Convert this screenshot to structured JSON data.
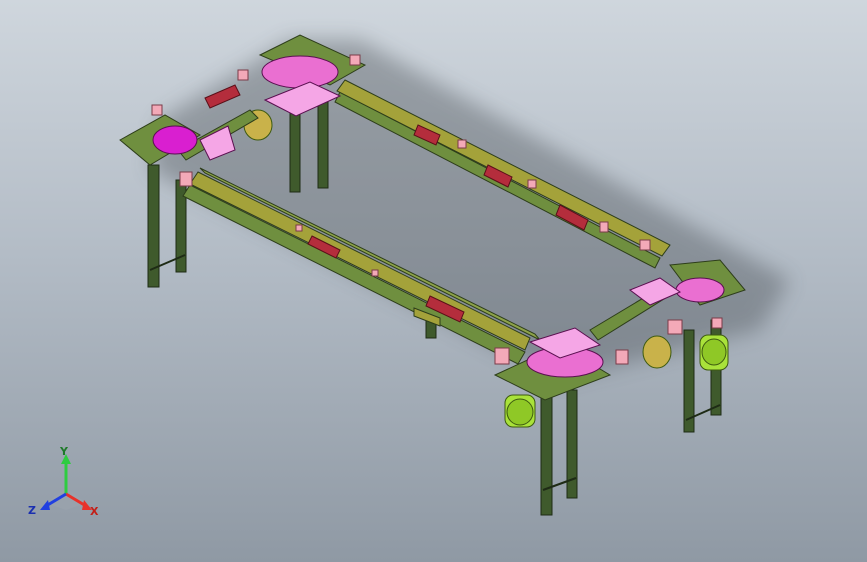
{
  "viewport": {
    "background_top": "#cfd6dd",
    "background_bottom": "#8f99a4"
  },
  "model": {
    "type": "conveyor-frame-assembly",
    "colors": {
      "frame": "#6f8f3f",
      "rail": "#a4a23a",
      "pink": "#ea6fd1",
      "magenta": "#d91fd0",
      "red_block": "#b42d3c",
      "motor": "#a9e23a",
      "leg": "#3f5a2c"
    }
  },
  "triad": {
    "y_label": "Y",
    "x_label": "X",
    "z_label": "Z",
    "y_color": "#2ecc40",
    "x_color": "#e8322a",
    "z_color": "#2140e0"
  }
}
